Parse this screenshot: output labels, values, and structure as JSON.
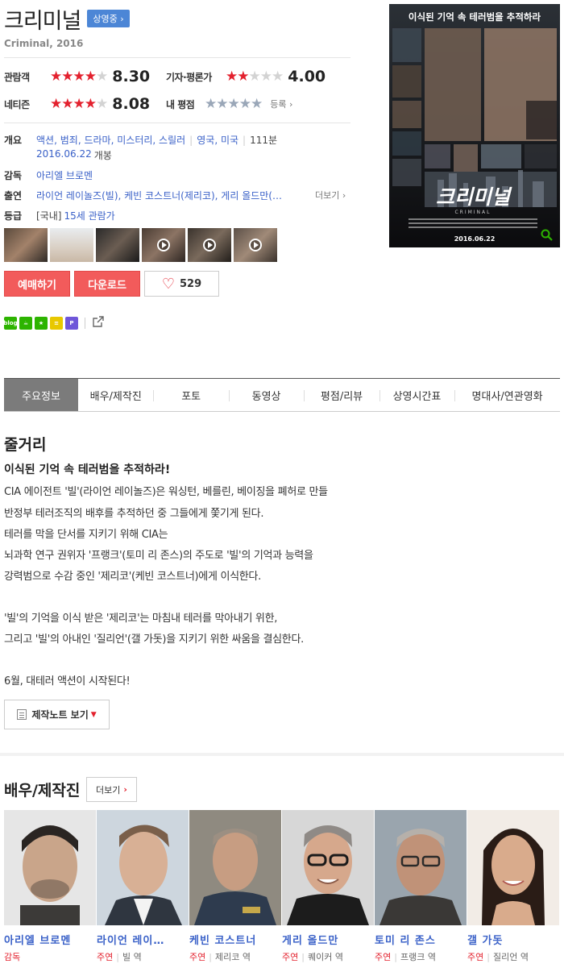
{
  "header": {
    "title": "크리미널",
    "status_badge": "상영중 ›",
    "original_title": "Criminal, 2016"
  },
  "ratings": {
    "audience": {
      "label": "관람객",
      "score": "8.30",
      "stars": 4
    },
    "critic": {
      "label": "기자·평론가",
      "score": "4.00",
      "stars": 2
    },
    "netizen": {
      "label": "네티즌",
      "score": "8.08",
      "stars": 4
    },
    "my_rating": {
      "label": "내 평점",
      "stars": 5,
      "link": "등록 ›"
    }
  },
  "info": {
    "overview_label": "개요",
    "genres": [
      "액션",
      "범죄",
      "드라마",
      "미스터리",
      "스릴러"
    ],
    "countries": [
      "영국",
      "미국"
    ],
    "runtime": "111분",
    "release_date": "2016.06.22",
    "release_suffix": "개봉",
    "director_label": "감독",
    "director": "아리엘 브로멘",
    "cast_label": "출연",
    "cast_text": "라이언 레이놀즈(빌), 케빈 코스트너(제리코), 게리 올드만(…",
    "cast_more": "더보기 ›",
    "grade_label": "등급",
    "grade_country": "[국내]",
    "grade": "15세 관람가"
  },
  "actions": {
    "reserve": "예매하기",
    "download": "다운로드",
    "likes": "529"
  },
  "share_icons": [
    {
      "name": "blog-share-icon",
      "color": "#2db400",
      "text": "blog"
    },
    {
      "name": "cafe-share-icon",
      "color": "#2db400",
      "text": "☕"
    },
    {
      "name": "bookmark-share-icon",
      "color": "#2db400",
      "text": "★"
    },
    {
      "name": "band-share-icon",
      "color": "#e8c800",
      "text": "≡"
    },
    {
      "name": "post-share-icon",
      "color": "#6f56d9",
      "text": "P"
    }
  ],
  "tabs": [
    "주요정보",
    "배우/제작진",
    "포토",
    "동영상",
    "평점/리뷰",
    "상영시간표",
    "명대사/연관영화"
  ],
  "synopsis": {
    "heading": "줄거리",
    "tagline": "이식된 기억 속 테러범을 추적하라!",
    "lines": [
      "CIA 에이전트 '빌'(라이언 레이놀즈)은 워싱턴, 베를린, 베이징을 폐허로 만들",
      " 반정부 테러조직의 배후를 추적하던 중 그들에게 쫓기게 된다.",
      " 테러를 막을 단서를 지키기 위해 CIA는",
      " 뇌과학 연구 권위자 '프랭크'(토미 리 존스)의 주도로 '빌'의 기억과 능력을",
      " 강력범으로 수감 중인 '제리코'(케빈 코스트너)에게 이식한다.",
      " '빌'의 기억을 이식 받은 '제리코'는 마침내 테러를 막아내기 위한,",
      " 그리고 '빌'의 아내인 '질리언'(갤 가돗)을 지키기 위한 싸움을 결심한다.",
      " 6월, 대테러 액션이 시작된다!"
    ],
    "note_button": "제작노트 보기"
  },
  "cast_section": {
    "heading": "배우/제작진",
    "more_label": "더보기",
    "members": [
      {
        "name": "아리엘 브로멘",
        "type": "감독",
        "role": ""
      },
      {
        "name": "라이언 레이…",
        "type": "주연",
        "role": "빌 역"
      },
      {
        "name": "케빈 코스트너",
        "type": "주연",
        "role": "제리코 역"
      },
      {
        "name": "게리 올드만",
        "type": "주연",
        "role": "퀘이커 역"
      },
      {
        "name": "토미 리 존스",
        "type": "주연",
        "role": "프랭크 역"
      },
      {
        "name": "갤 가돗",
        "type": "주연",
        "role": "질리언 역"
      }
    ]
  },
  "poster": {
    "tagline": "이식된 기억 속 테러범을 추적하라",
    "title": "크리미널",
    "subtitle": "CRIMINAL",
    "date": "2016.06.22"
  }
}
